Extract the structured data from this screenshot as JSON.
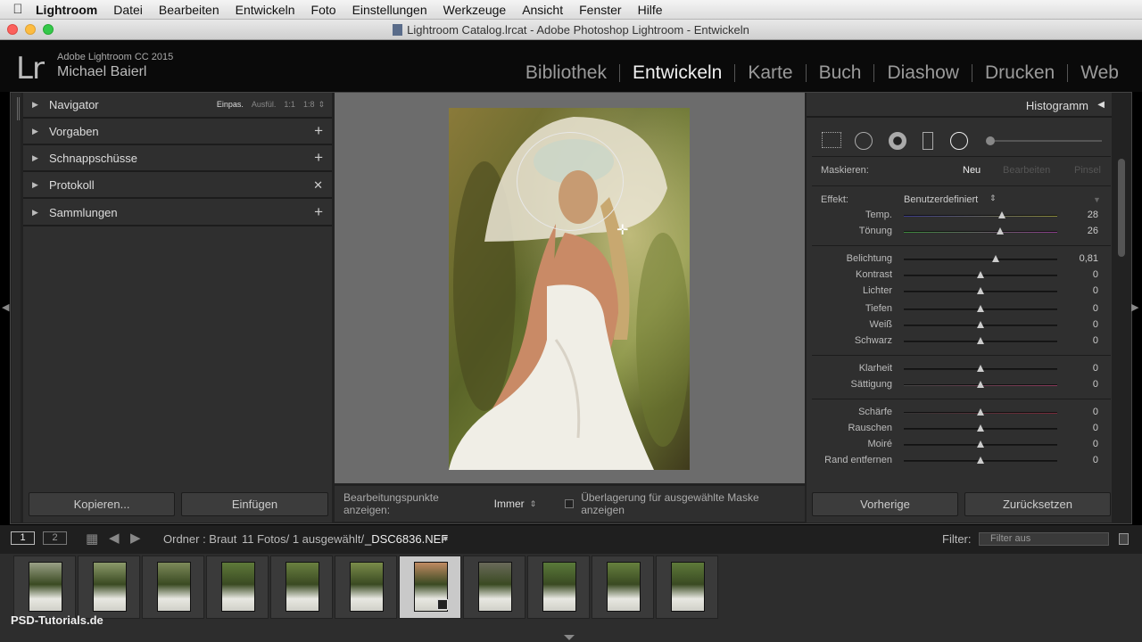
{
  "menubar": {
    "app": "Lightroom",
    "items": [
      "Datei",
      "Bearbeiten",
      "Entwickeln",
      "Foto",
      "Einstellungen",
      "Werkzeuge",
      "Ansicht",
      "Fenster",
      "Hilfe"
    ]
  },
  "window": {
    "title": "Lightroom Catalog.lrcat - Adobe Photoshop Lightroom - Entwickeln"
  },
  "identity": {
    "logo": "Lr",
    "version": "Adobe Lightroom CC 2015",
    "user": "Michael Baierl"
  },
  "modules": [
    "Bibliothek",
    "Entwickeln",
    "Karte",
    "Buch",
    "Diashow",
    "Drucken",
    "Web"
  ],
  "active_module": "Entwickeln",
  "left_panel": {
    "navigator": {
      "label": "Navigator",
      "options": [
        "Einpas.",
        "Ausfül.",
        "1:1",
        "1:8"
      ]
    },
    "sections": [
      {
        "label": "Vorgaben",
        "action": "+"
      },
      {
        "label": "Schnappschüsse",
        "action": "+"
      },
      {
        "label": "Protokoll",
        "action": "✕"
      },
      {
        "label": "Sammlungen",
        "action": "+"
      }
    ],
    "copy_button": "Kopieren...",
    "paste_button": "Einfügen"
  },
  "toolbar": {
    "show_points_label": "Bearbeitungspunkte anzeigen:",
    "show_points_value": "Immer",
    "overlay_label": "Überlagerung für ausgewählte Maske anzeigen"
  },
  "right_panel": {
    "histogram_title": "Histogramm",
    "mask_label": "Maskieren:",
    "mask_new": "Neu",
    "mask_edit": "Bearbeiten",
    "mask_brush": "Pinsel",
    "effect_label": "Effekt:",
    "effect_value": "Benutzerdefiniert",
    "sliders": [
      {
        "label": "Temp.",
        "value": "28",
        "pos": 0.64
      },
      {
        "label": "Tönung",
        "value": "26",
        "pos": 0.63
      },
      {
        "label": "Belichtung",
        "value": "0,81",
        "pos": 0.6
      },
      {
        "label": "Kontrast",
        "value": "0",
        "pos": 0.5
      },
      {
        "label": "Lichter",
        "value": "0",
        "pos": 0.5
      },
      {
        "label": "Tiefen",
        "value": "0",
        "pos": 0.5
      },
      {
        "label": "Weiß",
        "value": "0",
        "pos": 0.5
      },
      {
        "label": "Schwarz",
        "value": "0",
        "pos": 0.5
      },
      {
        "label": "Klarheit",
        "value": "0",
        "pos": 0.5
      },
      {
        "label": "Sättigung",
        "value": "0",
        "pos": 0.5
      },
      {
        "label": "Schärfe",
        "value": "0",
        "pos": 0.5
      },
      {
        "label": "Rauschen",
        "value": "0",
        "pos": 0.5
      },
      {
        "label": "Moiré",
        "value": "0",
        "pos": 0.5
      },
      {
        "label": "Rand entfernen",
        "value": "0",
        "pos": 0.5
      }
    ],
    "prev_button": "Vorherige",
    "reset_button": "Zurücksetzen"
  },
  "filmstrip": {
    "screen1": "1",
    "screen2": "2",
    "folder": "Ordner : Braut",
    "count": "11 Fotos/ 1 ausgewählt/",
    "filename": "_DSC6836.NEF",
    "filter_label": "Filter:",
    "filter_value": "Filter aus",
    "thumb_count": 11,
    "selected_index": 6
  },
  "watermark": "PSD-Tutorials.de"
}
